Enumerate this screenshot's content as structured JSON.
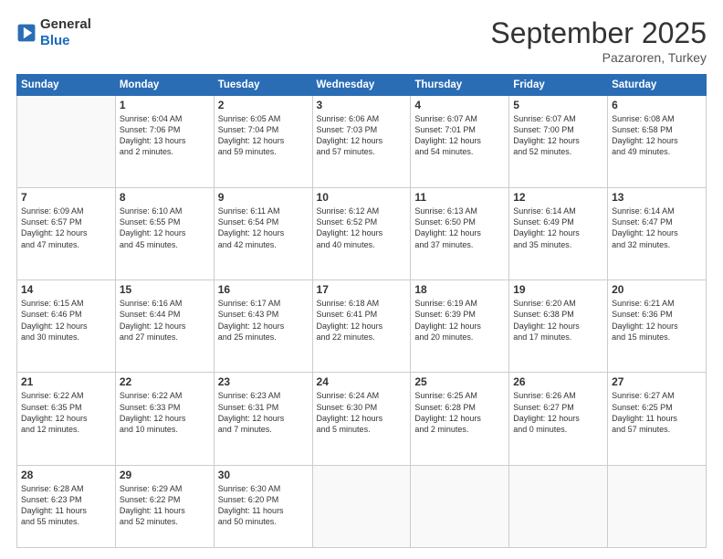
{
  "header": {
    "logo_general": "General",
    "logo_blue": "Blue",
    "title": "September 2025",
    "location": "Pazaroren, Turkey"
  },
  "weekdays": [
    "Sunday",
    "Monday",
    "Tuesday",
    "Wednesday",
    "Thursday",
    "Friday",
    "Saturday"
  ],
  "weeks": [
    [
      {
        "day": "",
        "info": ""
      },
      {
        "day": "1",
        "info": "Sunrise: 6:04 AM\nSunset: 7:06 PM\nDaylight: 13 hours\nand 2 minutes."
      },
      {
        "day": "2",
        "info": "Sunrise: 6:05 AM\nSunset: 7:04 PM\nDaylight: 12 hours\nand 59 minutes."
      },
      {
        "day": "3",
        "info": "Sunrise: 6:06 AM\nSunset: 7:03 PM\nDaylight: 12 hours\nand 57 minutes."
      },
      {
        "day": "4",
        "info": "Sunrise: 6:07 AM\nSunset: 7:01 PM\nDaylight: 12 hours\nand 54 minutes."
      },
      {
        "day": "5",
        "info": "Sunrise: 6:07 AM\nSunset: 7:00 PM\nDaylight: 12 hours\nand 52 minutes."
      },
      {
        "day": "6",
        "info": "Sunrise: 6:08 AM\nSunset: 6:58 PM\nDaylight: 12 hours\nand 49 minutes."
      }
    ],
    [
      {
        "day": "7",
        "info": "Sunrise: 6:09 AM\nSunset: 6:57 PM\nDaylight: 12 hours\nand 47 minutes."
      },
      {
        "day": "8",
        "info": "Sunrise: 6:10 AM\nSunset: 6:55 PM\nDaylight: 12 hours\nand 45 minutes."
      },
      {
        "day": "9",
        "info": "Sunrise: 6:11 AM\nSunset: 6:54 PM\nDaylight: 12 hours\nand 42 minutes."
      },
      {
        "day": "10",
        "info": "Sunrise: 6:12 AM\nSunset: 6:52 PM\nDaylight: 12 hours\nand 40 minutes."
      },
      {
        "day": "11",
        "info": "Sunrise: 6:13 AM\nSunset: 6:50 PM\nDaylight: 12 hours\nand 37 minutes."
      },
      {
        "day": "12",
        "info": "Sunrise: 6:14 AM\nSunset: 6:49 PM\nDaylight: 12 hours\nand 35 minutes."
      },
      {
        "day": "13",
        "info": "Sunrise: 6:14 AM\nSunset: 6:47 PM\nDaylight: 12 hours\nand 32 minutes."
      }
    ],
    [
      {
        "day": "14",
        "info": "Sunrise: 6:15 AM\nSunset: 6:46 PM\nDaylight: 12 hours\nand 30 minutes."
      },
      {
        "day": "15",
        "info": "Sunrise: 6:16 AM\nSunset: 6:44 PM\nDaylight: 12 hours\nand 27 minutes."
      },
      {
        "day": "16",
        "info": "Sunrise: 6:17 AM\nSunset: 6:43 PM\nDaylight: 12 hours\nand 25 minutes."
      },
      {
        "day": "17",
        "info": "Sunrise: 6:18 AM\nSunset: 6:41 PM\nDaylight: 12 hours\nand 22 minutes."
      },
      {
        "day": "18",
        "info": "Sunrise: 6:19 AM\nSunset: 6:39 PM\nDaylight: 12 hours\nand 20 minutes."
      },
      {
        "day": "19",
        "info": "Sunrise: 6:20 AM\nSunset: 6:38 PM\nDaylight: 12 hours\nand 17 minutes."
      },
      {
        "day": "20",
        "info": "Sunrise: 6:21 AM\nSunset: 6:36 PM\nDaylight: 12 hours\nand 15 minutes."
      }
    ],
    [
      {
        "day": "21",
        "info": "Sunrise: 6:22 AM\nSunset: 6:35 PM\nDaylight: 12 hours\nand 12 minutes."
      },
      {
        "day": "22",
        "info": "Sunrise: 6:22 AM\nSunset: 6:33 PM\nDaylight: 12 hours\nand 10 minutes."
      },
      {
        "day": "23",
        "info": "Sunrise: 6:23 AM\nSunset: 6:31 PM\nDaylight: 12 hours\nand 7 minutes."
      },
      {
        "day": "24",
        "info": "Sunrise: 6:24 AM\nSunset: 6:30 PM\nDaylight: 12 hours\nand 5 minutes."
      },
      {
        "day": "25",
        "info": "Sunrise: 6:25 AM\nSunset: 6:28 PM\nDaylight: 12 hours\nand 2 minutes."
      },
      {
        "day": "26",
        "info": "Sunrise: 6:26 AM\nSunset: 6:27 PM\nDaylight: 12 hours\nand 0 minutes."
      },
      {
        "day": "27",
        "info": "Sunrise: 6:27 AM\nSunset: 6:25 PM\nDaylight: 11 hours\nand 57 minutes."
      }
    ],
    [
      {
        "day": "28",
        "info": "Sunrise: 6:28 AM\nSunset: 6:23 PM\nDaylight: 11 hours\nand 55 minutes."
      },
      {
        "day": "29",
        "info": "Sunrise: 6:29 AM\nSunset: 6:22 PM\nDaylight: 11 hours\nand 52 minutes."
      },
      {
        "day": "30",
        "info": "Sunrise: 6:30 AM\nSunset: 6:20 PM\nDaylight: 11 hours\nand 50 minutes."
      },
      {
        "day": "",
        "info": ""
      },
      {
        "day": "",
        "info": ""
      },
      {
        "day": "",
        "info": ""
      },
      {
        "day": "",
        "info": ""
      }
    ]
  ]
}
